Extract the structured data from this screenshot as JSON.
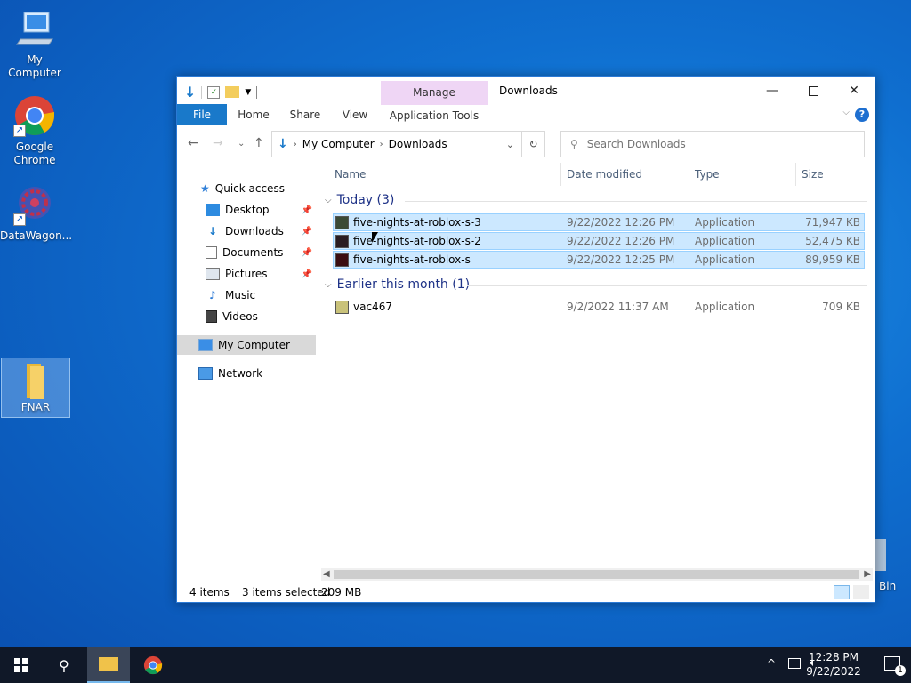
{
  "desktop": {
    "icons": [
      {
        "label": "My Computer"
      },
      {
        "label": "Google Chrome"
      },
      {
        "label": "DataWagon..."
      },
      {
        "label": "FNAR"
      }
    ],
    "recycle_label": "Bin"
  },
  "window": {
    "manage_tab": "Manage",
    "title": "Downloads",
    "ribbon_tabs": [
      "File",
      "Home",
      "Share",
      "View",
      "Application Tools"
    ],
    "breadcrumb": [
      "My Computer",
      "Downloads"
    ],
    "search_placeholder": "Search Downloads"
  },
  "nav": {
    "quick_access": "Quick access",
    "items": [
      "Desktop",
      "Downloads",
      "Documents",
      "Pictures",
      "Music",
      "Videos"
    ],
    "my_computer": "My Computer",
    "network": "Network"
  },
  "columns": {
    "name": "Name",
    "date": "Date modified",
    "type": "Type",
    "size": "Size"
  },
  "groups": [
    {
      "label": "Today (3)",
      "files": [
        {
          "name": "five-nights-at-roblox-s-3",
          "date": "9/22/2022 12:26 PM",
          "type": "Application",
          "size": "71,947 KB",
          "selected": true
        },
        {
          "name": "five-nights-at-roblox-s-2",
          "date": "9/22/2022 12:26 PM",
          "type": "Application",
          "size": "52,475 KB",
          "selected": true
        },
        {
          "name": "five-nights-at-roblox-s",
          "date": "9/22/2022 12:25 PM",
          "type": "Application",
          "size": "89,959 KB",
          "selected": true
        }
      ]
    },
    {
      "label": "Earlier this month (1)",
      "files": [
        {
          "name": "vac467",
          "date": "9/2/2022 11:37 AM",
          "type": "Application",
          "size": "709 KB",
          "selected": false
        }
      ]
    }
  ],
  "status": {
    "items": "4 items",
    "selected": "3 items selected",
    "size": "209 MB"
  },
  "taskbar": {
    "time": "12:28 PM",
    "date": "9/22/2022",
    "notif_count": "1"
  },
  "colors": {
    "accent": "#1979ca",
    "selection": "#cce8ff",
    "group_text": "#1e3287",
    "taskbar": "#101828"
  }
}
